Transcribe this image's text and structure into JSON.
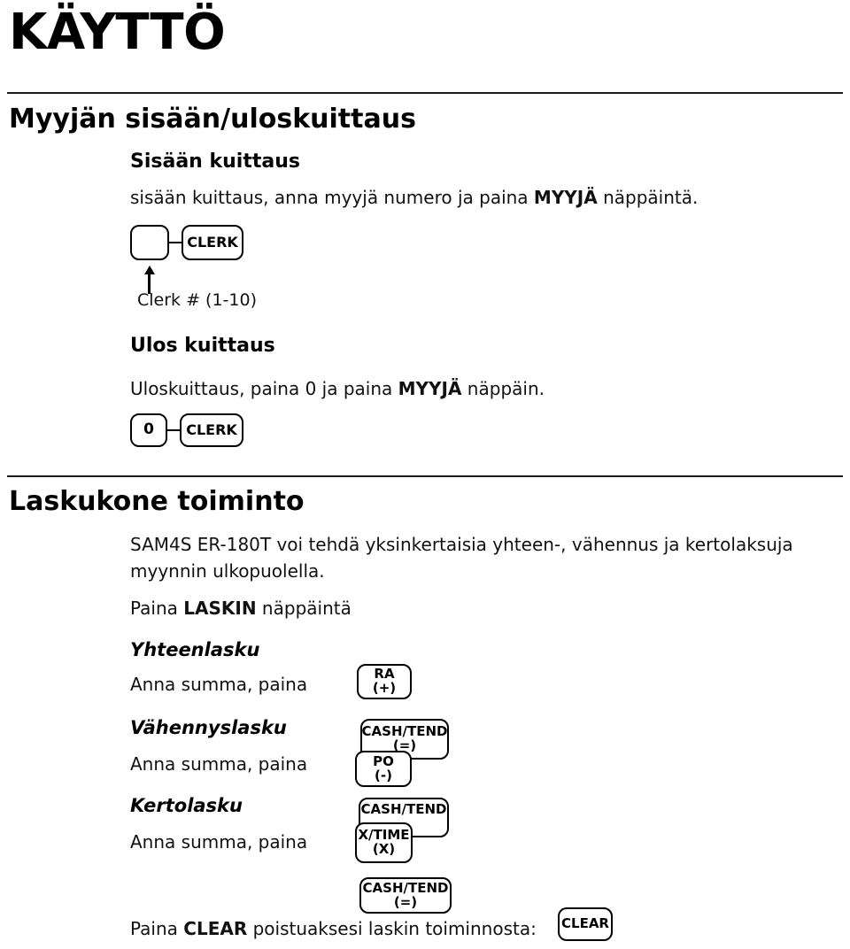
{
  "document": {
    "title": "KÄYTTÖ"
  },
  "sections": {
    "clerk": {
      "heading": "Myyjän sisään/uloskuittaus",
      "sign_in": {
        "heading": "Sisään kuittaus",
        "description_pre": "sisään kuittaus, anna myyjä numero ja paina ",
        "description_bold": "MYYJÄ",
        "description_post": " näppäintä.",
        "keys": [
          {
            "line1": "",
            "line2": ""
          },
          {
            "line1": "CLERK",
            "line2": ""
          }
        ],
        "caption": "Clerk # (1-10)"
      },
      "sign_out": {
        "heading": "Ulos kuittaus",
        "description_pre": "Uloskuittaus, paina 0 ja paina ",
        "description_bold": "MYYJÄ",
        "description_post": " näppäin.",
        "keys": [
          {
            "line1": "0",
            "line2": ""
          },
          {
            "line1": "CLERK",
            "line2": ""
          }
        ]
      }
    },
    "calculator": {
      "heading": "Laskukone toiminto",
      "description": "SAM4S ER-180T voi tehdä yksinkertaisia yhteen-, vähennus ja kertolaksuja myynnin ulkopuolella.",
      "press_pre": "Paina ",
      "press_bold": "LASKIN",
      "press_post": " näppäintä",
      "operations": [
        {
          "name": "Yhteenlasku",
          "instruction": "Anna summa, paina",
          "keys": [
            {
              "line1": "RA",
              "line2": "(+)"
            }
          ]
        },
        {
          "name": "Vähennyslasku",
          "instruction": "Anna summa, paina",
          "keys": [
            {
              "line1": "CASH/TEND",
              "line2": "(=)"
            },
            {
              "line1": "PO",
              "line2": "(-)"
            }
          ]
        },
        {
          "name": "Kertolasku",
          "instruction": "Anna summa, paina",
          "keys": [
            {
              "line1": "CASH/TEND",
              "line2": ""
            },
            {
              "line1": "X/TIME",
              "line2": "(X)"
            },
            {
              "line1": "CASH/TEND",
              "line2": "(=)"
            }
          ]
        }
      ],
      "exit": {
        "text_pre": "Paina ",
        "text_bold": "CLEAR",
        "text_post": " poistuaksesi laskin toiminnosta:",
        "key": {
          "line1": "CLEAR",
          "line2": ""
        }
      }
    }
  },
  "colors": {
    "ink": "#000000",
    "rule": "#1a1a1a",
    "paper": "#ffffff"
  }
}
